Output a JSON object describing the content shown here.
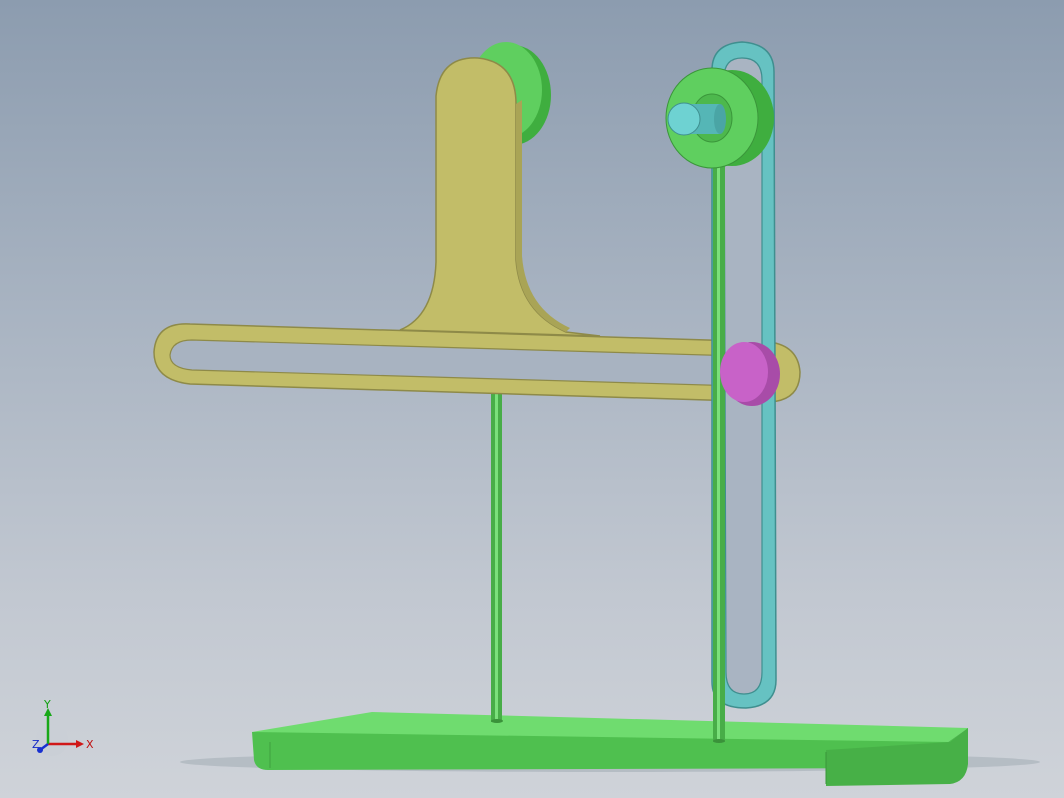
{
  "triad": {
    "x_label": "X",
    "y_label": "Y",
    "z_label": "Z",
    "x_color": "#d01818",
    "y_color": "#18a818",
    "z_color": "#1830d0"
  },
  "colors": {
    "frame_green": "#5fcf5f",
    "crank_green": "#4db84d",
    "slotted_arm": "#c2bd68",
    "slotted_link": "#66c2c2",
    "slider_pin": "#c862c8",
    "pin_cyan": "#6ed2d2"
  }
}
